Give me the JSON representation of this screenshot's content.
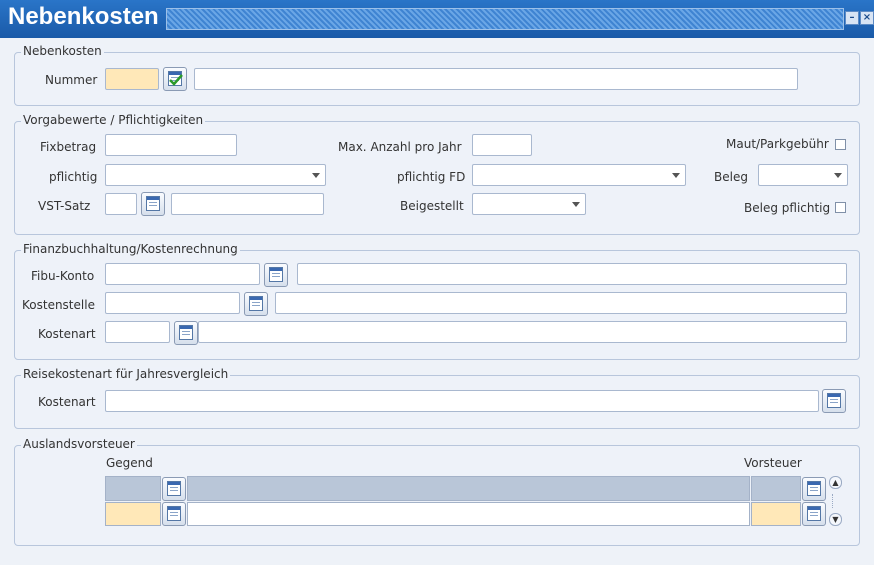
{
  "window": {
    "title": "Nebenkosten"
  },
  "nebenkosten": {
    "group_label": "Nebenkosten",
    "nummer_label": "Nummer",
    "nummer_value": "",
    "description_value": ""
  },
  "vorgabewerte": {
    "group_label": "Vorgabewerte / Pflichtigkeiten",
    "fixbetrag_label": "Fixbetrag",
    "pflichtig_label": "pflichtig",
    "vst_satz_label": "VST-Satz",
    "max_anzahl_label": "Max. Anzahl pro Jahr",
    "pflichtig_fd_label": "pflichtig FD",
    "beigestellt_label": "Beigestellt",
    "maut_label": "Maut/Parkgebühr",
    "beleg_label": "Beleg",
    "beleg_pflichtig_label": "Beleg pflichtig"
  },
  "finanz": {
    "group_label": "Finanzbuchhaltung/Kostenrechnung",
    "fibu_label": "Fibu-Konto",
    "kostenstelle_label": "Kostenstelle",
    "kostenart_label": "Kostenart"
  },
  "reise": {
    "group_label": "Reisekostenart für Jahresvergleich",
    "kostenart_label": "Kostenart"
  },
  "ausland": {
    "group_label": "Auslandsvorsteuer",
    "gegend_header": "Gegend",
    "vorsteuer_header": "Vorsteuer"
  },
  "colors": {
    "titlebar": "#1a5aa8",
    "required_field": "#ffe8b8",
    "background": "#eef2f8"
  }
}
